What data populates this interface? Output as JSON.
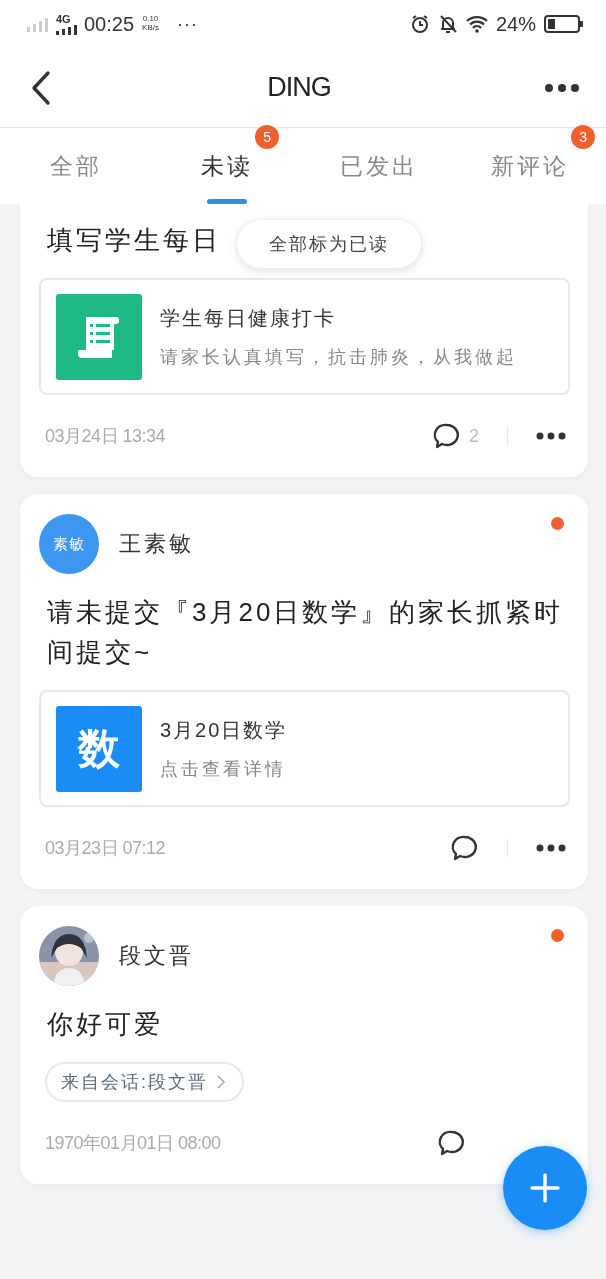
{
  "status_bar": {
    "network": "4G",
    "time": "00:25",
    "speed_value": "0.10",
    "speed_unit": "KB/s",
    "more": "···",
    "battery": "24%"
  },
  "header": {
    "title": "DING"
  },
  "tabs": [
    {
      "label": "全部",
      "selected": false
    },
    {
      "label": "未读",
      "selected": true,
      "badge": "5"
    },
    {
      "label": "已发出",
      "selected": false
    },
    {
      "label": "新评论",
      "selected": false,
      "badge": "3"
    }
  ],
  "popup": {
    "label": "全部标为已读"
  },
  "cards": [
    {
      "unread": false,
      "message": "填写学生每日",
      "attachment": {
        "kind": "form",
        "title": "学生每日健康打卡",
        "subtitle": "请家长认真填写，抗击肺炎，从我做起"
      },
      "date": "03月24日 13:34",
      "comment_count": "2",
      "more": true
    },
    {
      "unread": true,
      "author": {
        "name": "王素敏",
        "avatar": {
          "kind": "initials",
          "text": "素敏"
        }
      },
      "message": "请未提交『3月20日数学』的家长抓紧时间提交~",
      "attachment": {
        "kind": "glyph",
        "icon_text": "数",
        "title": "3月20日数学",
        "subtitle": "点击查看详情"
      },
      "date": "03月23日 07:12",
      "more": true
    },
    {
      "unread": true,
      "author": {
        "name": "段文晋"
      },
      "message": "你好可爱",
      "source": "来自会话:段文晋",
      "date": "1970年01月01日 08:00",
      "more": false
    }
  ]
}
